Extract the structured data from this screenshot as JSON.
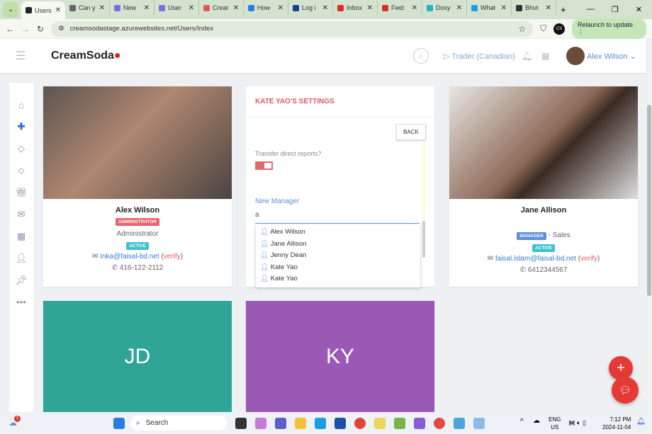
{
  "browser": {
    "tabs": [
      {
        "label": "Users",
        "active": true
      },
      {
        "label": "Can y"
      },
      {
        "label": "New"
      },
      {
        "label": "User"
      },
      {
        "label": "Crear"
      },
      {
        "label": "How"
      },
      {
        "label": "Log i"
      },
      {
        "label": "Inbox"
      },
      {
        "label": "Fwd:"
      },
      {
        "label": "Doxy"
      },
      {
        "label": "What"
      },
      {
        "label": "Bhut"
      }
    ],
    "url": "creamsodastage.azurewebsites.net/Users/Index",
    "relaunch": "Relaunch to update",
    "profile": "CS"
  },
  "header": {
    "logo": "CreamSoda",
    "role": "Trader (Canadian)",
    "user": "Alex Wilson"
  },
  "sidebar": {
    "icons": [
      "home-icon",
      "plus-icon",
      "diamond-icon",
      "tag-icon",
      "gift-icon",
      "mail-icon",
      "calendar-icon",
      "user-icon",
      "pin-icon",
      "more-icon"
    ]
  },
  "cards": [
    {
      "name": "Alex Wilson",
      "badge": "ADMINISTRATOR",
      "badge_color": "#e8636b",
      "role": "Administrator",
      "status": "ACTIVE",
      "email": "Inka@faisal-bd.net",
      "verify": "verify",
      "phone": "416-122-2112"
    },
    {
      "name": "Jane Allison",
      "badge": "MANAGER",
      "badge_color": "#5b8fd9",
      "role": "- Sales",
      "status": "ACTIVE",
      "email": "faisal.islam@faisal-bd.net",
      "verify": "verify",
      "phone": "6412344567"
    },
    {
      "initials": "JD",
      "color": "#2fa597"
    },
    {
      "initials": "KY",
      "color": "#9b59b6"
    }
  ],
  "settings": {
    "title": "KATE YAO'S SETTINGS",
    "back": "BACK",
    "transfer_label": "Transfer direct reports?",
    "transfer_on": true,
    "manager_label": "New Manager",
    "manager_value": "a",
    "suggestions": [
      "Alex Wilson",
      "Jane Allison",
      "Jenny Dean",
      "Kate Yao",
      "Kate Yao"
    ]
  },
  "taskbar": {
    "search": "Search",
    "lang": "ENG",
    "region": "US",
    "time": "7:12 PM",
    "date": "2024-11-04",
    "notif_count": "1"
  }
}
